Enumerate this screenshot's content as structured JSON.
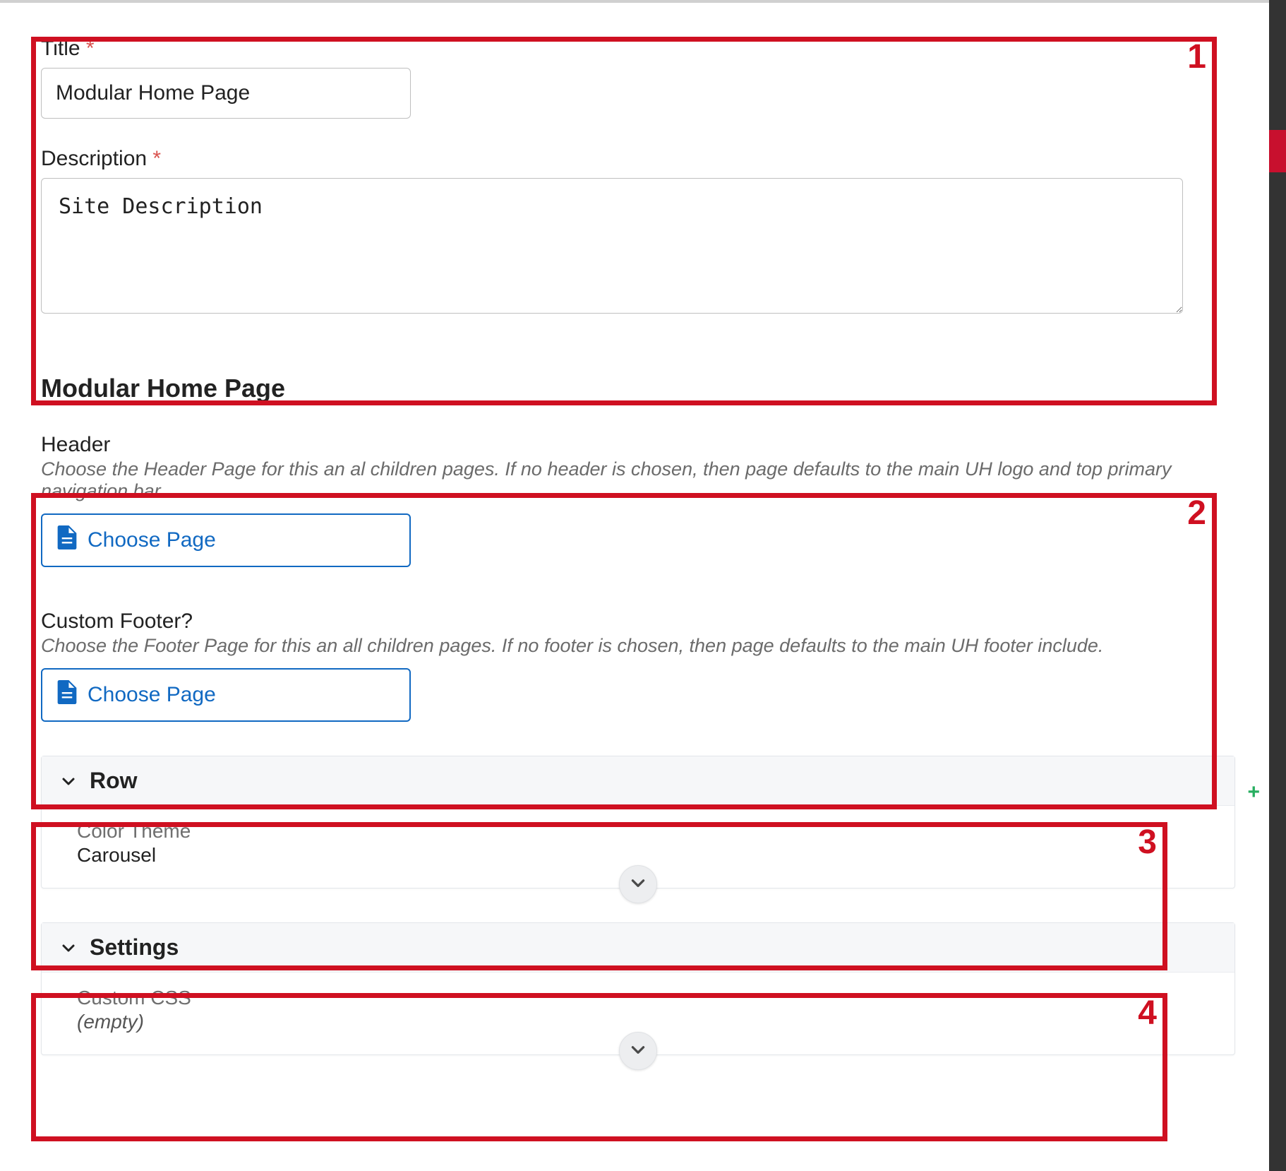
{
  "form": {
    "title_label": "Title",
    "title_value": "Modular Home Page",
    "description_label": "Description",
    "description_value": "Site Description",
    "required_marker": "*"
  },
  "section_title": "Modular Home Page",
  "header_block": {
    "label": "Header",
    "helper": "Choose the Header Page for this an al children pages. If no header is chosen, then page defaults to the main UH logo and top primary navigation bar.",
    "button": "Choose Page"
  },
  "footer_block": {
    "label": "Custom Footer?",
    "helper": "Choose the Footer Page for this an all children pages. If no footer is chosen, then page defaults to the main UH footer include.",
    "button": "Choose Page"
  },
  "row_panel": {
    "title": "Row",
    "color_theme_label": "Color Theme",
    "carousel_label": "Carousel"
  },
  "settings_panel": {
    "title": "Settings",
    "custom_css_label": "Custom CSS",
    "empty_text": "(empty)"
  },
  "annotations": {
    "n1": "1",
    "n2": "2",
    "n3": "3",
    "n4": "4"
  }
}
